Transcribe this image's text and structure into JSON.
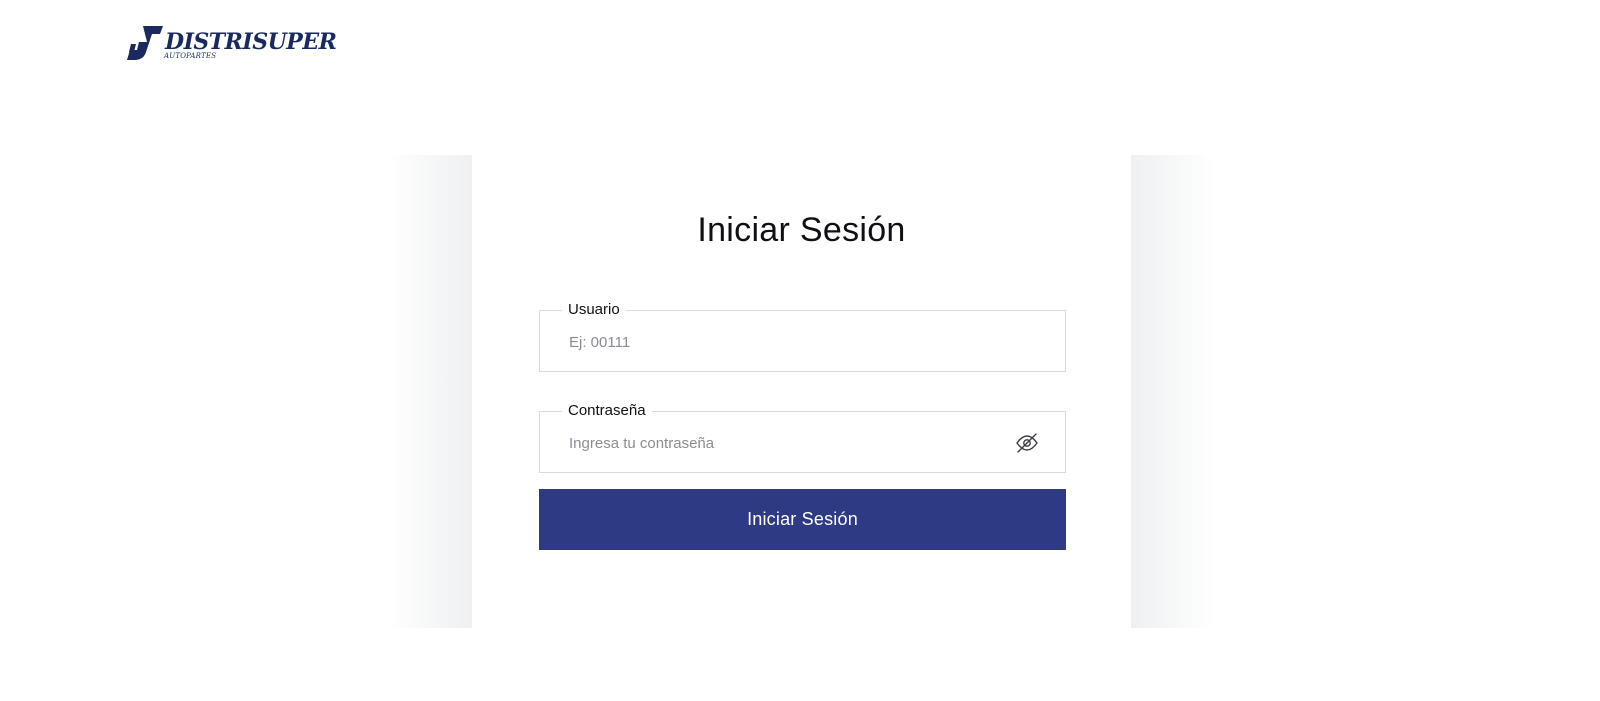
{
  "brand": {
    "name": "DISTRISUPER",
    "tagline": "AUTOPARTES",
    "color": "#1a2a5e"
  },
  "login": {
    "title": "Iniciar Sesión",
    "user_field": {
      "label": "Usuario",
      "placeholder": "Ej: 00111",
      "value": ""
    },
    "password_field": {
      "label": "Contraseña",
      "placeholder": "Ingresa tu contraseña",
      "value": "",
      "toggle_icon": "eye-off-icon"
    },
    "submit_label": "Iniciar Sesión",
    "accent_color": "#2e3b84"
  }
}
